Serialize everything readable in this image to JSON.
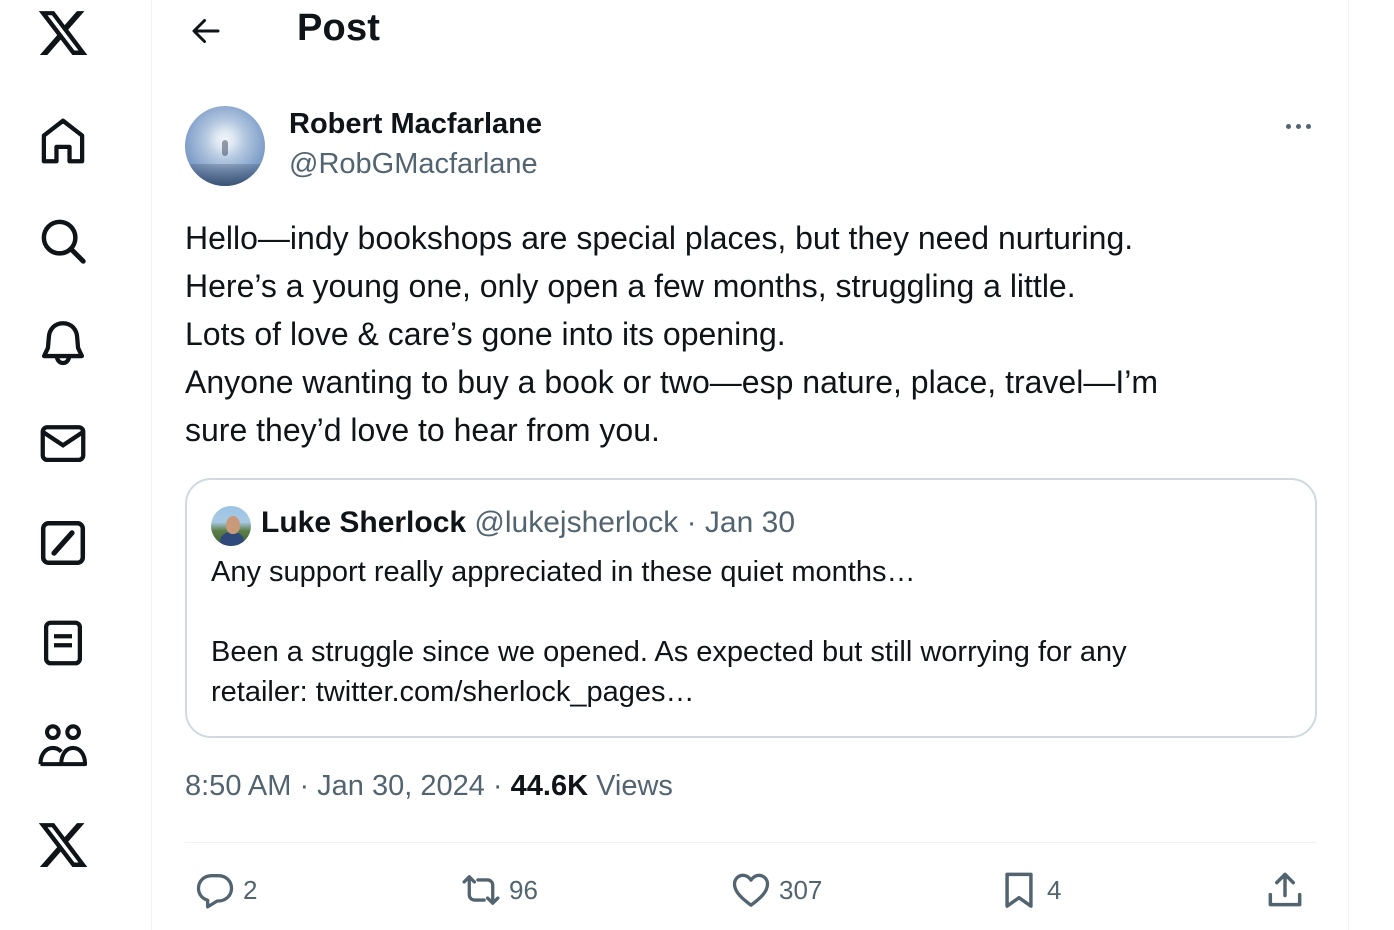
{
  "nav": {
    "items": [
      {
        "name": "x-logo-icon"
      },
      {
        "name": "home-icon"
      },
      {
        "name": "search-icon"
      },
      {
        "name": "notifications-bell-icon"
      },
      {
        "name": "messages-envelope-icon"
      },
      {
        "name": "grok-icon"
      },
      {
        "name": "lists-icon"
      },
      {
        "name": "communities-icon"
      },
      {
        "name": "premium-x-icon"
      }
    ]
  },
  "header": {
    "title": "Post",
    "back_icon": "arrow-left-icon"
  },
  "tweet": {
    "author_name": "Robert Macfarlane",
    "author_handle": "@RobGMacfarlane",
    "lines": [
      "Hello—indy bookshops are special places, but they need nurturing.",
      "Here’s a young one, only open a few months, struggling a little.",
      "Lots of love & care’s gone into its opening.",
      "Anyone wanting to buy a book or two—esp nature, place, travel—I’m",
      "sure they’d love to hear from you."
    ],
    "quote": {
      "name": "Luke Sherlock",
      "meta": " @lukejsherlock · Jan 30",
      "lines": [
        "Any support really appreciated in these quiet months…",
        "",
        "Been a struggle since we opened. As expected but still worrying for any",
        "retailer: twitter.com/sherlock_pages…"
      ]
    },
    "timestamp": "8:50 AM · Jan 30, 2024 · ",
    "views_count": "44.6K",
    "views_label": " Views",
    "actions": {
      "replies": "2",
      "reposts": "96",
      "likes": "307",
      "bookmarks": "4"
    }
  },
  "colors": {
    "text": "#0f1419",
    "secondary": "#536471",
    "border": "#cfd9de",
    "divider": "#eff3f4"
  }
}
